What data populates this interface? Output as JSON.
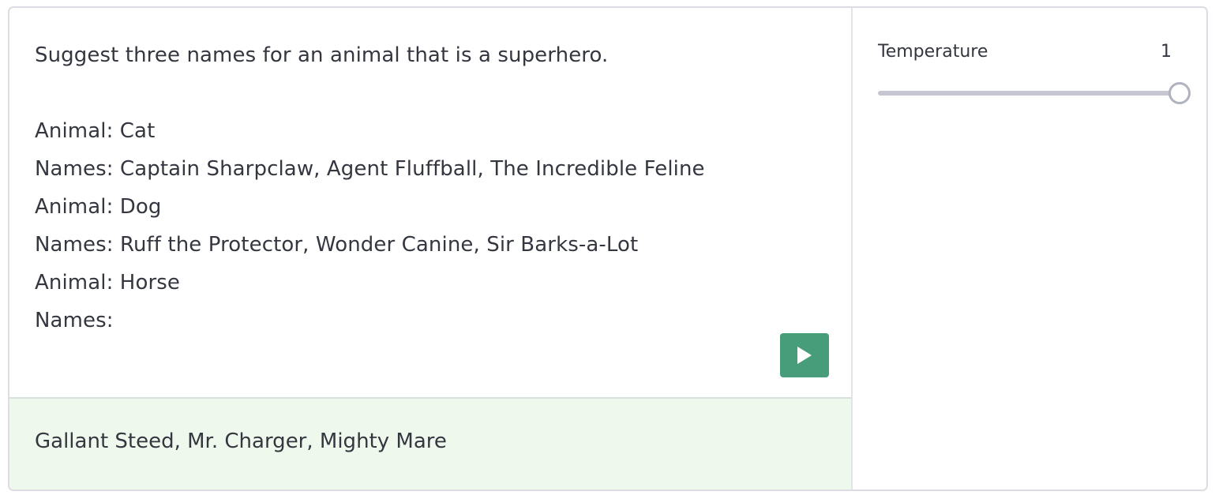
{
  "prompt": {
    "text": "Suggest three names for an animal that is a superhero.\n\nAnimal: Cat\nNames: Captain Sharpclaw, Agent Fluffball, The Incredible Feline\nAnimal: Dog\nNames: Ruff the Protector, Wonder Canine, Sir Barks-a-Lot\nAnimal: Horse\nNames:"
  },
  "run_button": {
    "icon": "play-icon",
    "color": "#479d79"
  },
  "output": {
    "text": "Gallant Steed, Mr. Charger, Mighty Mare",
    "background": "#eef8ec"
  },
  "settings": {
    "temperature": {
      "label": "Temperature",
      "value": "1",
      "slider_fraction": 1.0
    }
  }
}
